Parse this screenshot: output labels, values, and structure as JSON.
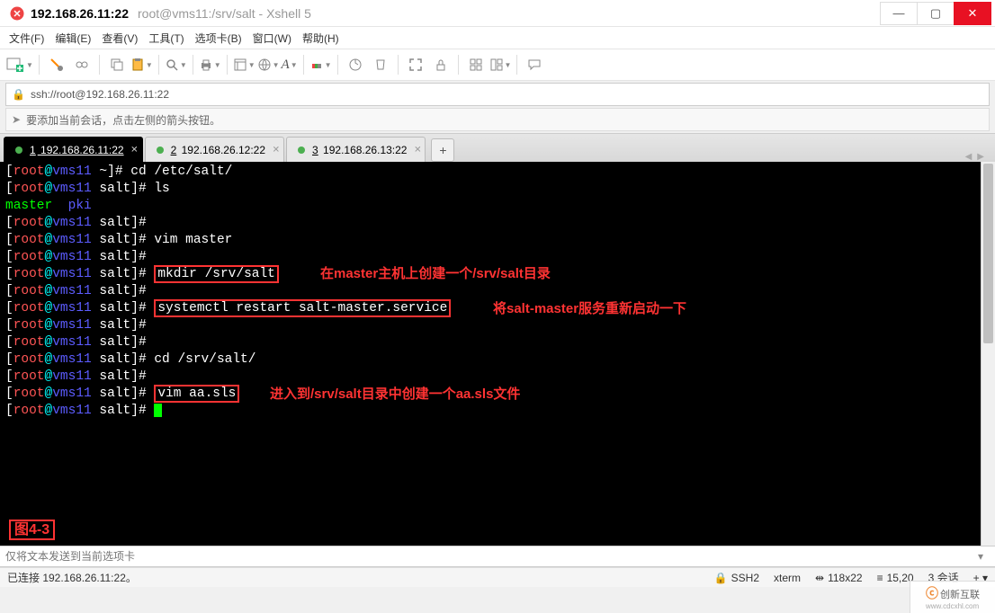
{
  "window": {
    "title_main": "192.168.26.11:22",
    "title_sub": "root@vms11:/srv/salt - Xshell 5"
  },
  "menu": {
    "file": "文件(F)",
    "edit": "编辑(E)",
    "view": "查看(V)",
    "tools": "工具(T)",
    "tabs": "选项卡(B)",
    "window": "窗口(W)",
    "help": "帮助(H)"
  },
  "address": {
    "url": "ssh://root@192.168.26.11:22"
  },
  "hint": {
    "text": "要添加当前会话，点击左侧的箭头按钮。"
  },
  "tabs": [
    {
      "index": "1",
      "label": "192.168.26.11:22",
      "active": true
    },
    {
      "index": "2",
      "label": "192.168.26.12:22",
      "active": false
    },
    {
      "index": "3",
      "label": "192.168.26.13:22",
      "active": false
    }
  ],
  "terminal": {
    "lines": [
      {
        "user": "root",
        "host": "vms11",
        "dir": "~",
        "cmd": "cd /etc/salt/"
      },
      {
        "user": "root",
        "host": "vms11",
        "dir": "salt",
        "cmd": "ls"
      },
      {
        "raw_ls": true,
        "file1": "master",
        "file2": "pki"
      },
      {
        "user": "root",
        "host": "vms11",
        "dir": "salt",
        "cmd": ""
      },
      {
        "user": "root",
        "host": "vms11",
        "dir": "salt",
        "cmd": "vim master"
      },
      {
        "user": "root",
        "host": "vms11",
        "dir": "salt",
        "cmd": ""
      },
      {
        "user": "root",
        "host": "vms11",
        "dir": "salt",
        "cmd": "mkdir /srv/salt",
        "boxed": true
      },
      {
        "user": "root",
        "host": "vms11",
        "dir": "salt",
        "cmd": ""
      },
      {
        "user": "root",
        "host": "vms11",
        "dir": "salt",
        "cmd": "systemctl restart salt-master.service",
        "boxed": true
      },
      {
        "user": "root",
        "host": "vms11",
        "dir": "salt",
        "cmd": ""
      },
      {
        "user": "root",
        "host": "vms11",
        "dir": "salt",
        "cmd": ""
      },
      {
        "user": "root",
        "host": "vms11",
        "dir": "salt",
        "cmd": "cd /srv/salt/"
      },
      {
        "user": "root",
        "host": "vms11",
        "dir": "salt",
        "cmd": ""
      },
      {
        "user": "root",
        "host": "vms11",
        "dir": "salt",
        "cmd": "vim aa.sls",
        "boxed": true
      },
      {
        "user": "root",
        "host": "vms11",
        "dir": "salt",
        "cmd": "",
        "cursor": true
      }
    ],
    "annotations": {
      "a1": "在master主机上创建一个/srv/salt目录",
      "a2": "将salt-master服务重新启动一下",
      "a3": "进入到/srv/salt目录中创建一个aa.sls文件"
    },
    "figlabel": "图4-3"
  },
  "sendbar": {
    "placeholder": "仅将文本发送到当前选项卡"
  },
  "status": {
    "conn": "已连接  192.168.26.11:22。",
    "ssh": "SSH2",
    "term": "xterm",
    "size": "118x22",
    "pos": "15,20",
    "sessions": "3 会话"
  },
  "watermark": {
    "brand": "创新互联",
    "sub": "www.cdcxhl.com"
  }
}
